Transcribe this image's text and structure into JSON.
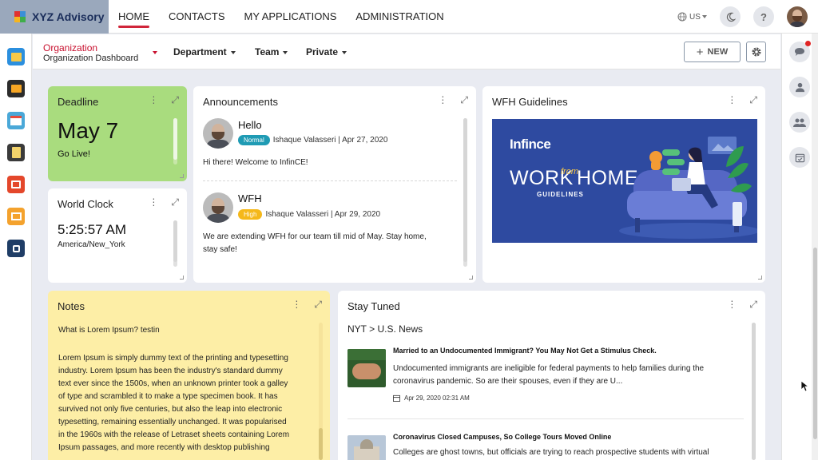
{
  "app": {
    "brand": "XYZ Advisory"
  },
  "nav": {
    "items": [
      "HOME",
      "CONTACTS",
      "MY APPLICATIONS",
      "ADMINISTRATION"
    ],
    "active": "HOME"
  },
  "topbar": {
    "language": "US"
  },
  "filters": {
    "org_label": "Organization",
    "org_value": "Organization Dashboard",
    "department": "Department",
    "team": "Team",
    "private": "Private",
    "new_button": "NEW"
  },
  "deadline": {
    "title": "Deadline",
    "date": "May 7",
    "note": "Go Live!"
  },
  "world_clock": {
    "title": "World Clock",
    "time": "5:25:57 AM",
    "zone": "America/New_York"
  },
  "announcements": {
    "title": "Announcements",
    "items": [
      {
        "heading": "Hello",
        "badge": "Normal",
        "author_date": "Ishaque Valasseri | Apr 27, 2020",
        "body": "Hi there! Welcome to InfinCE!"
      },
      {
        "heading": "WFH",
        "badge": "High",
        "author_date": "Ishaque Valasseri | Apr 29, 2020",
        "body_line1": "We are extending WFH for our team till mid of May. Stay home,",
        "body_line2": "stay safe!"
      }
    ]
  },
  "wfh": {
    "title": "WFH Guidelines",
    "banner_brand": "Infince",
    "banner_work": "WORK",
    "banner_from": "from",
    "banner_home": "HOME",
    "banner_guidelines": "GUIDELINES"
  },
  "notes": {
    "title": "Notes",
    "first_line": "What is Lorem Ipsum? testin",
    "lines": [
      "Lorem Ipsum is simply dummy text of the printing and typesetting",
      "industry. Lorem Ipsum has been the industry's standard dummy",
      "text ever since the 1500s, when an unknown printer took a galley",
      "of type and scrambled it to make a type specimen book. It has",
      "survived not only five centuries, but also the leap into electronic",
      "typesetting, remaining essentially unchanged. It was popularised",
      "in the 1960s with the release of Letraset sheets containing Lorem",
      "Ipsum passages, and more recently with desktop publishing"
    ]
  },
  "stay_tuned": {
    "title": "Stay Tuned",
    "source": "NYT > U.S. News",
    "items": [
      {
        "headline": "Married to an Undocumented Immigrant? You May Not Get a Stimulus Check.",
        "summary_line1": "Undocumented immigrants are ineligible for federal payments to help families during the",
        "summary_line2": "coronavirus pandemic. So are their spouses, even if they are U...",
        "date": "Apr 29, 2020 02:31 AM"
      },
      {
        "headline": "Coronavirus Closed Campuses, So College Tours Moved Online",
        "summary_line1": "Colleges are ghost towns, but officials are trying to reach prospective students with virtual"
      }
    ]
  },
  "colors": {
    "accent": "#d0253a",
    "deadline_bg": "#a9dc7e",
    "notes_bg": "#fdeea6",
    "banner_bg": "#2e4aa0",
    "badge_normal": "#1f9bb4",
    "badge_high": "#f5b81a"
  }
}
